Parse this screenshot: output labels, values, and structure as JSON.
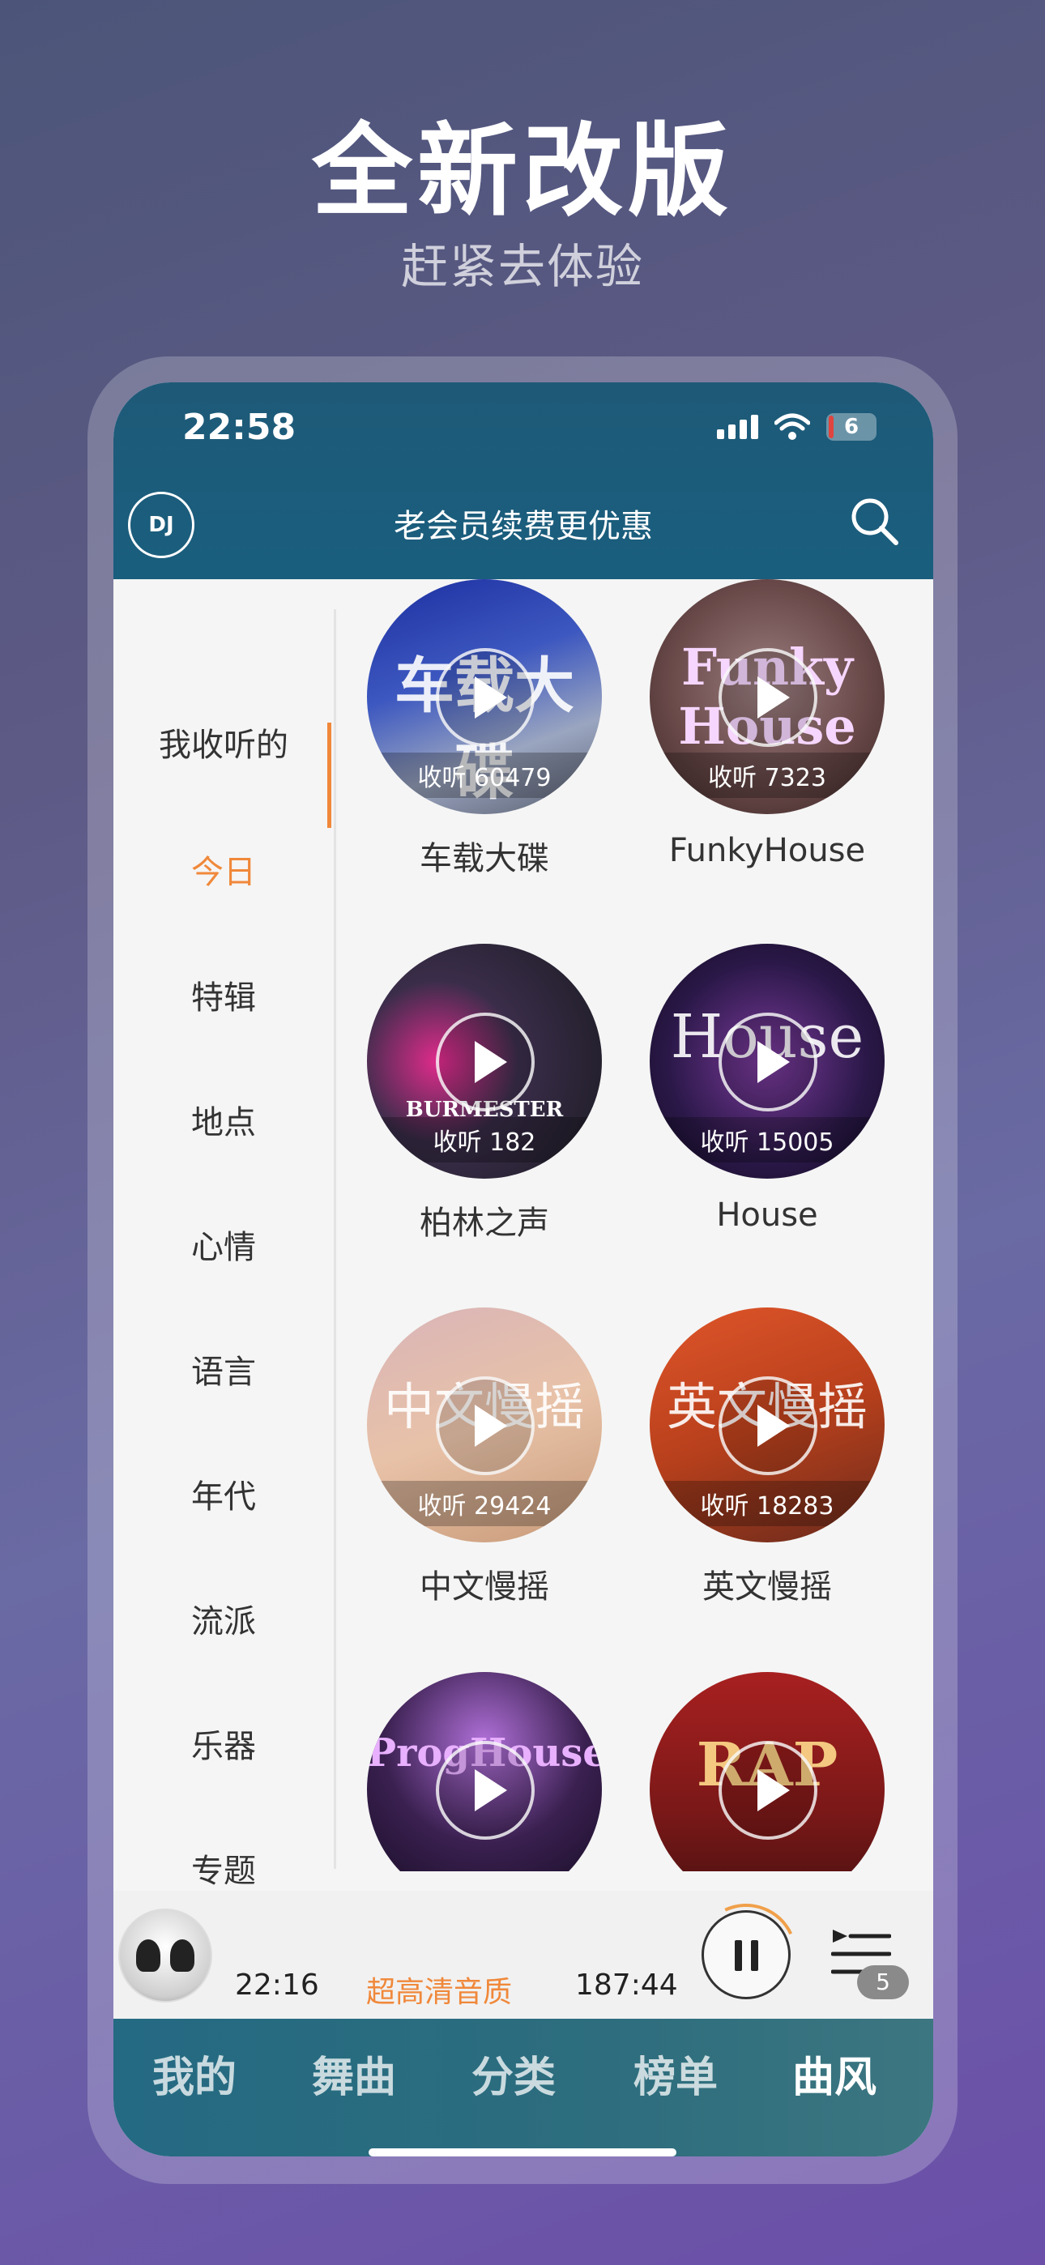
{
  "promo": {
    "headline": "全新改版",
    "subhead": "赶紧去体验"
  },
  "status_bar": {
    "time": "22:58",
    "battery": "6"
  },
  "header": {
    "logo_text": "DJ",
    "title": "老会员续费更优惠",
    "search_icon": "search-icon"
  },
  "sidebar": {
    "items": [
      {
        "label": "我收听的"
      },
      {
        "label": "今日"
      },
      {
        "label": "特辑"
      },
      {
        "label": "地点"
      },
      {
        "label": "心情"
      },
      {
        "label": "语言"
      },
      {
        "label": "年代"
      },
      {
        "label": "流派"
      },
      {
        "label": "乐器"
      },
      {
        "label": "专题"
      }
    ],
    "active_index": 1
  },
  "playlists": [
    {
      "title": "车载大碟",
      "plays": "收听 60479",
      "cover_text": "车载大碟"
    },
    {
      "title": "FunkyHouse",
      "plays": "收听 7323",
      "cover_text": "Funky House"
    },
    {
      "title": "柏林之声",
      "plays": "收听 182",
      "cover_text": "BURMESTER"
    },
    {
      "title": "House",
      "plays": "收听 15005",
      "cover_text": "House"
    },
    {
      "title": "中文慢摇",
      "plays": "收听 29424",
      "cover_text": "中文慢摇"
    },
    {
      "title": "英文慢摇",
      "plays": "收听 18283",
      "cover_text": "英文慢摇"
    },
    {
      "title": "",
      "plays": "",
      "cover_text": "ProgHouse"
    },
    {
      "title": "",
      "plays": "",
      "cover_text": "RAP"
    }
  ],
  "player": {
    "current_time": "22:16",
    "quality": "超高清音质",
    "duration": "187:44",
    "queue_count": "5"
  },
  "tabs": [
    {
      "label": "我的"
    },
    {
      "label": "舞曲"
    },
    {
      "label": "分类"
    },
    {
      "label": "榜单"
    },
    {
      "label": "曲风"
    }
  ],
  "active_tab": 4,
  "colors": {
    "accent": "#f0883a",
    "header": "#1e5a78"
  }
}
